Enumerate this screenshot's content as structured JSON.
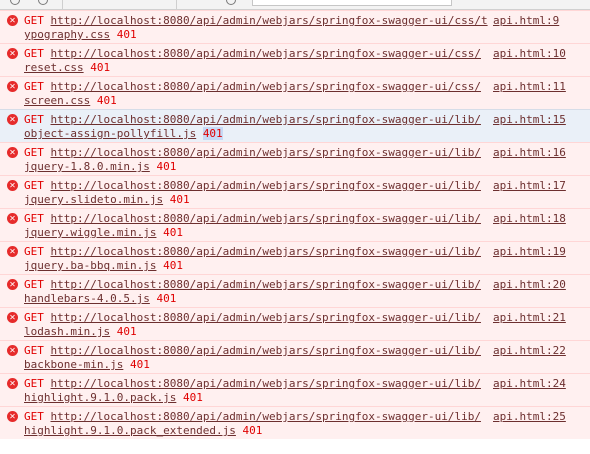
{
  "rows": [
    {
      "method": "GET",
      "url_a": "http://localhost:8080/api/admin/webjars/springfox-swagger-ui/css/t",
      "url_b": "ypography.css",
      "status": "401",
      "source": "api.html:9"
    },
    {
      "method": "GET",
      "url_a": "http://localhost:8080/api/admin/webjars/springfox-swagger-ui/css/",
      "url_b": "reset.css",
      "status": "401",
      "source": "api.html:10"
    },
    {
      "method": "GET",
      "url_a": "http://localhost:8080/api/admin/webjars/springfox-swagger-ui/css/",
      "url_b": "screen.css",
      "status": "401",
      "source": "api.html:11"
    },
    {
      "method": "GET",
      "url_a": "http://localhost:8080/api/admin/webjars/springfox-swagger-ui/lib/",
      "url_b": "object-assign-pollyfill.js",
      "status": "401",
      "source": "api.html:15"
    },
    {
      "method": "GET",
      "url_a": "http://localhost:8080/api/admin/webjars/springfox-swagger-ui/lib/",
      "url_b": "jquery-1.8.0.min.js",
      "status": "401",
      "source": "api.html:16"
    },
    {
      "method": "GET",
      "url_a": "http://localhost:8080/api/admin/webjars/springfox-swagger-ui/lib/",
      "url_b": "jquery.slideto.min.js",
      "status": "401",
      "source": "api.html:17"
    },
    {
      "method": "GET",
      "url_a": "http://localhost:8080/api/admin/webjars/springfox-swagger-ui/lib/",
      "url_b": "jquery.wiggle.min.js",
      "status": "401",
      "source": "api.html:18"
    },
    {
      "method": "GET",
      "url_a": "http://localhost:8080/api/admin/webjars/springfox-swagger-ui/lib/",
      "url_b": "jquery.ba-bbq.min.js",
      "status": "401",
      "source": "api.html:19"
    },
    {
      "method": "GET",
      "url_a": "http://localhost:8080/api/admin/webjars/springfox-swagger-ui/lib/",
      "url_b": "handlebars-4.0.5.js",
      "status": "401",
      "source": "api.html:20"
    },
    {
      "method": "GET",
      "url_a": "http://localhost:8080/api/admin/webjars/springfox-swagger-ui/lib/",
      "url_b": "lodash.min.js",
      "status": "401",
      "source": "api.html:21"
    },
    {
      "method": "GET",
      "url_a": "http://localhost:8080/api/admin/webjars/springfox-swagger-ui/lib/",
      "url_b": "backbone-min.js",
      "status": "401",
      "source": "api.html:22"
    },
    {
      "method": "GET",
      "url_a": "http://localhost:8080/api/admin/webjars/springfox-swagger-ui/lib/",
      "url_b": "highlight.9.1.0.pack.js",
      "status": "401",
      "source": "api.html:24"
    },
    {
      "method": "GET",
      "url_a": "http://localhost:8080/api/admin/webjars/springfox-swagger-ui/lib/",
      "url_b": "highlight.9.1.0.pack_extended.js",
      "status": "401",
      "source": "api.html:25"
    }
  ],
  "error_icon": "error-circle-x",
  "colors": {
    "error_bg": "#fff0f0",
    "error_text": "#e00000",
    "link_text": "#6d2f2f",
    "highlight_bg": "#eaf0f8"
  }
}
